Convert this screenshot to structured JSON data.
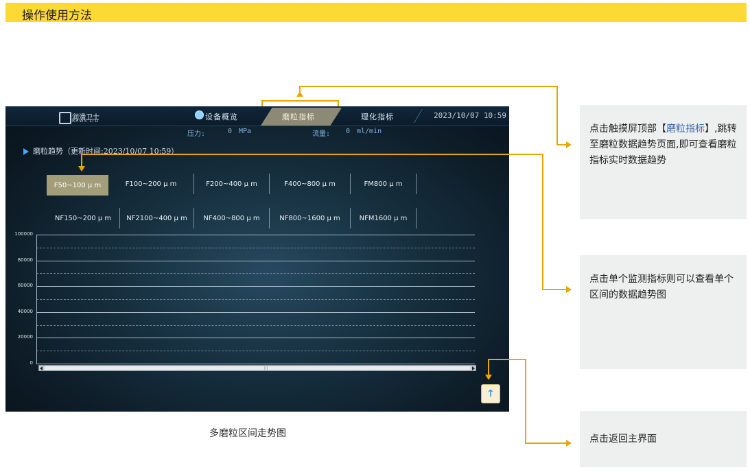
{
  "header": {
    "title": "操作使用方法"
  },
  "app": {
    "logo_cn": "润滑卫士",
    "logo_en": "RHWS LTD",
    "nav": [
      "设备概览",
      "磨粒指标",
      "理化指标"
    ],
    "active_tab": "磨粒指标",
    "datetime": "2023/10/07 10:59",
    "pressure_label": "压力:",
    "pressure_value": "0",
    "pressure_unit": "MPa",
    "flow_label": "流量:",
    "flow_value": "0",
    "flow_unit": "ml/min"
  },
  "trend": {
    "title": "磨粒趋势（更新时间:2023/10/07 10:59）"
  },
  "buttons_row1": [
    "F50~100 μ m",
    "F100~200 μ m",
    "F200~400 μ m",
    "F400~800 μ m",
    "FM800 μ m"
  ],
  "buttons_row2": [
    "NF150~200 μ m",
    "NF2100~400 μ m",
    "NF400~800 μ m",
    "NF800~1600 μ m",
    "NFM1600 μ m"
  ],
  "active_button": "F50~100 μ m",
  "chart_data": {
    "type": "line",
    "title": "",
    "xlabel": "",
    "ylabel": "",
    "ylim": [
      0,
      100000
    ],
    "yticks": [
      "100000",
      "80000",
      "60000",
      "40000",
      "20000",
      "0"
    ],
    "grid": true,
    "series": []
  },
  "caption": "多磨粒区间走势图",
  "notes": {
    "note1": {
      "pre": "点击触摸屏顶部【",
      "highlight": "磨粒指标",
      "post": "】,跳转至磨粒数据趋势页面,即可查看磨粒指标实时数据趋势"
    },
    "note2": "点击单个监测指标则可以查看单个区间的数据趋势图",
    "note3": "点击返回主界面"
  },
  "colors": {
    "accent": "#fcd935",
    "arrow": "#e8a700",
    "highlight": "#3a69a8"
  }
}
